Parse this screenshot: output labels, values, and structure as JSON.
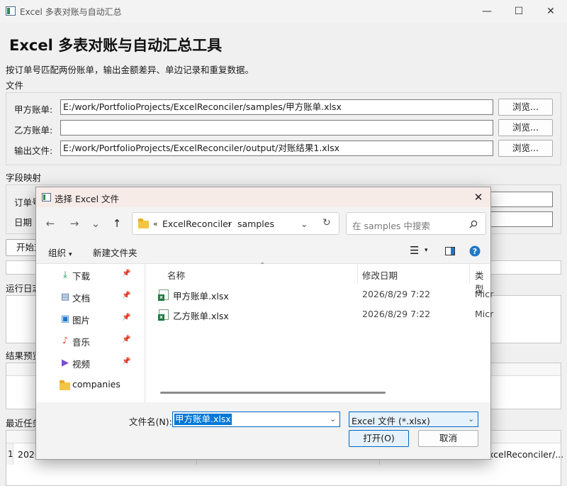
{
  "window": {
    "title": "Excel 多表对账与自动汇总",
    "minimize": "—",
    "maximize": "☐",
    "close": "✕"
  },
  "main": {
    "heading": "Excel 多表对账与自动汇总工具",
    "subtitle": "按订单号匹配两份账单，输出金额差异、单边记录和重复数据。",
    "files_section": "文件",
    "files": [
      {
        "label": "甲方账单:",
        "value": "E:/work/PortfolioProjects/ExcelReconciler/samples/甲方账单.xlsx",
        "browse": "浏览..."
      },
      {
        "label": "乙方账单:",
        "value": "",
        "browse": "浏览..."
      },
      {
        "label": "输出文件:",
        "value": "E:/work/PortfolioProjects/ExcelReconciler/output/对账结果1.xlsx",
        "browse": "浏览..."
      }
    ],
    "mapping_section": "字段映射",
    "mapping": [
      {
        "label": "订单号"
      },
      {
        "label": "日期"
      }
    ],
    "start_button": "开始对",
    "log_section": "运行日志",
    "preview_section": "结果预览",
    "recent_section": "最近任务",
    "recent_row": {
      "index": "1",
      "date": "2026",
      "path": "xcelReconciler/..."
    }
  },
  "dialog": {
    "title": "选择 Excel 文件",
    "close": "✕",
    "nav": {
      "back": "←",
      "forward": "→",
      "recent": "⌄",
      "up": "↑",
      "refresh": "↻"
    },
    "breadcrumb": [
      "«",
      "ExcelReconciler",
      "›",
      "samples"
    ],
    "search_placeholder": "在 samples 中搜索",
    "toolbar": {
      "organize": "组织",
      "new_folder": "新建文件夹"
    },
    "sidebar": [
      {
        "label": "下载",
        "icon": "download-icon",
        "glyph": "⤓",
        "color": "#1a8a5a"
      },
      {
        "label": "文档",
        "icon": "document-icon",
        "glyph": "▤",
        "color": "#4a6fa5"
      },
      {
        "label": "图片",
        "icon": "picture-icon",
        "glyph": "▣",
        "color": "#1e78c8"
      },
      {
        "label": "音乐",
        "icon": "music-icon",
        "glyph": "♪",
        "color": "#e0503a"
      },
      {
        "label": "视频",
        "icon": "video-icon",
        "glyph": "▶",
        "color": "#7a4ad0"
      },
      {
        "label": "companies",
        "icon": "folder-icon",
        "glyph": "",
        "color": "#f4c542"
      }
    ],
    "columns": {
      "name": "名称",
      "modified": "修改日期",
      "type": "类型"
    },
    "files": [
      {
        "name": "甲方账单.xlsx",
        "modified": "2026/8/29 7:22",
        "type": "Micr"
      },
      {
        "name": "乙方账单.xlsx",
        "modified": "2026/8/29 7:22",
        "type": "Micr"
      }
    ],
    "filename_label": "文件名(N):",
    "filename_value": "甲方账单.xlsx",
    "filetype_value": "Excel 文件 (*.xlsx)",
    "open_button": "打开(O)",
    "cancel_button": "取消"
  }
}
